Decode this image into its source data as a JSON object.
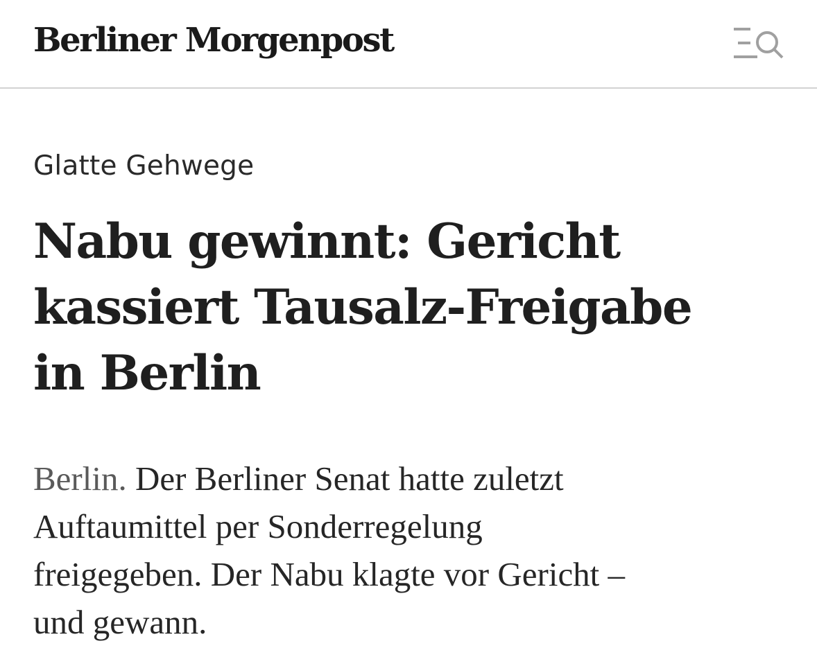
{
  "header": {
    "logo_text": "Berliner Morgenpost",
    "menu_search_icon": "menu-search-icon"
  },
  "article": {
    "kicker": "Glatte Gehwege",
    "headline_lines": [
      "Nabu gewinnt: Gericht",
      "kassiert Tausalz-Freigabe",
      "in Berlin"
    ],
    "teaser_dateline": "Berlin.",
    "teaser_lines": [
      " Der Berliner Senat hatte zuletzt",
      "Auftaumittel per Sonderregelung",
      "freigegeben. Der Nabu klagte vor Gericht –",
      "und gewann."
    ]
  },
  "colors": {
    "text": "#1f1f1f",
    "dateline": "#5a5a5a",
    "divider": "#d2d2d2",
    "icon": "#a0a0a0"
  }
}
